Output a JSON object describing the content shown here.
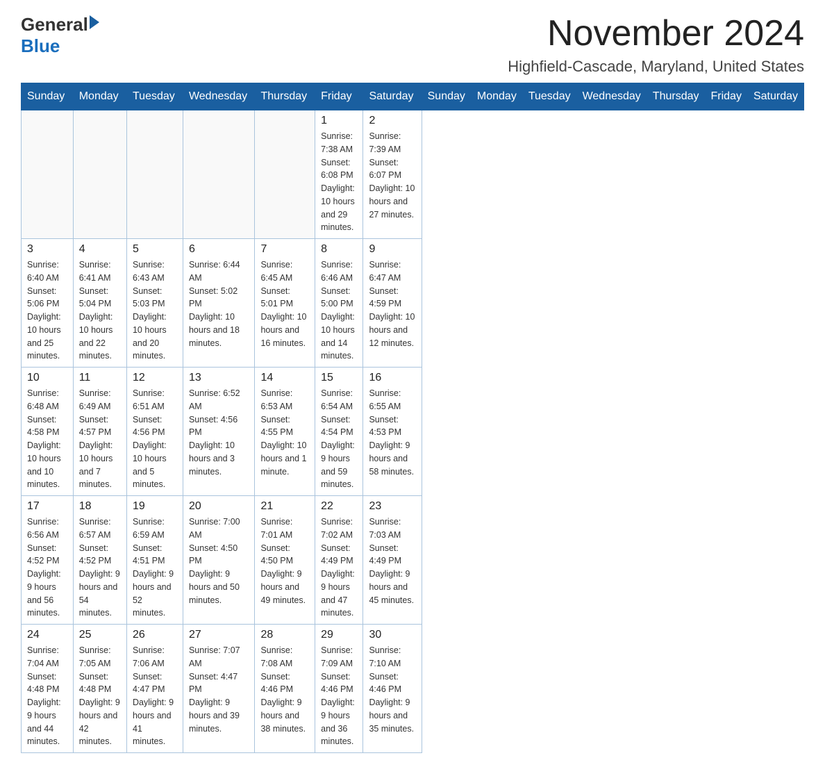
{
  "header": {
    "logo_general": "General",
    "logo_blue": "Blue",
    "month_title": "November 2024",
    "location": "Highfield-Cascade, Maryland, United States"
  },
  "days_of_week": [
    "Sunday",
    "Monday",
    "Tuesday",
    "Wednesday",
    "Thursday",
    "Friday",
    "Saturday"
  ],
  "weeks": [
    [
      {
        "day": "",
        "info": ""
      },
      {
        "day": "",
        "info": ""
      },
      {
        "day": "",
        "info": ""
      },
      {
        "day": "",
        "info": ""
      },
      {
        "day": "",
        "info": ""
      },
      {
        "day": "1",
        "info": "Sunrise: 7:38 AM\nSunset: 6:08 PM\nDaylight: 10 hours and 29 minutes."
      },
      {
        "day": "2",
        "info": "Sunrise: 7:39 AM\nSunset: 6:07 PM\nDaylight: 10 hours and 27 minutes."
      }
    ],
    [
      {
        "day": "3",
        "info": "Sunrise: 6:40 AM\nSunset: 5:06 PM\nDaylight: 10 hours and 25 minutes."
      },
      {
        "day": "4",
        "info": "Sunrise: 6:41 AM\nSunset: 5:04 PM\nDaylight: 10 hours and 22 minutes."
      },
      {
        "day": "5",
        "info": "Sunrise: 6:43 AM\nSunset: 5:03 PM\nDaylight: 10 hours and 20 minutes."
      },
      {
        "day": "6",
        "info": "Sunrise: 6:44 AM\nSunset: 5:02 PM\nDaylight: 10 hours and 18 minutes."
      },
      {
        "day": "7",
        "info": "Sunrise: 6:45 AM\nSunset: 5:01 PM\nDaylight: 10 hours and 16 minutes."
      },
      {
        "day": "8",
        "info": "Sunrise: 6:46 AM\nSunset: 5:00 PM\nDaylight: 10 hours and 14 minutes."
      },
      {
        "day": "9",
        "info": "Sunrise: 6:47 AM\nSunset: 4:59 PM\nDaylight: 10 hours and 12 minutes."
      }
    ],
    [
      {
        "day": "10",
        "info": "Sunrise: 6:48 AM\nSunset: 4:58 PM\nDaylight: 10 hours and 10 minutes."
      },
      {
        "day": "11",
        "info": "Sunrise: 6:49 AM\nSunset: 4:57 PM\nDaylight: 10 hours and 7 minutes."
      },
      {
        "day": "12",
        "info": "Sunrise: 6:51 AM\nSunset: 4:56 PM\nDaylight: 10 hours and 5 minutes."
      },
      {
        "day": "13",
        "info": "Sunrise: 6:52 AM\nSunset: 4:56 PM\nDaylight: 10 hours and 3 minutes."
      },
      {
        "day": "14",
        "info": "Sunrise: 6:53 AM\nSunset: 4:55 PM\nDaylight: 10 hours and 1 minute."
      },
      {
        "day": "15",
        "info": "Sunrise: 6:54 AM\nSunset: 4:54 PM\nDaylight: 9 hours and 59 minutes."
      },
      {
        "day": "16",
        "info": "Sunrise: 6:55 AM\nSunset: 4:53 PM\nDaylight: 9 hours and 58 minutes."
      }
    ],
    [
      {
        "day": "17",
        "info": "Sunrise: 6:56 AM\nSunset: 4:52 PM\nDaylight: 9 hours and 56 minutes."
      },
      {
        "day": "18",
        "info": "Sunrise: 6:57 AM\nSunset: 4:52 PM\nDaylight: 9 hours and 54 minutes."
      },
      {
        "day": "19",
        "info": "Sunrise: 6:59 AM\nSunset: 4:51 PM\nDaylight: 9 hours and 52 minutes."
      },
      {
        "day": "20",
        "info": "Sunrise: 7:00 AM\nSunset: 4:50 PM\nDaylight: 9 hours and 50 minutes."
      },
      {
        "day": "21",
        "info": "Sunrise: 7:01 AM\nSunset: 4:50 PM\nDaylight: 9 hours and 49 minutes."
      },
      {
        "day": "22",
        "info": "Sunrise: 7:02 AM\nSunset: 4:49 PM\nDaylight: 9 hours and 47 minutes."
      },
      {
        "day": "23",
        "info": "Sunrise: 7:03 AM\nSunset: 4:49 PM\nDaylight: 9 hours and 45 minutes."
      }
    ],
    [
      {
        "day": "24",
        "info": "Sunrise: 7:04 AM\nSunset: 4:48 PM\nDaylight: 9 hours and 44 minutes."
      },
      {
        "day": "25",
        "info": "Sunrise: 7:05 AM\nSunset: 4:48 PM\nDaylight: 9 hours and 42 minutes."
      },
      {
        "day": "26",
        "info": "Sunrise: 7:06 AM\nSunset: 4:47 PM\nDaylight: 9 hours and 41 minutes."
      },
      {
        "day": "27",
        "info": "Sunrise: 7:07 AM\nSunset: 4:47 PM\nDaylight: 9 hours and 39 minutes."
      },
      {
        "day": "28",
        "info": "Sunrise: 7:08 AM\nSunset: 4:46 PM\nDaylight: 9 hours and 38 minutes."
      },
      {
        "day": "29",
        "info": "Sunrise: 7:09 AM\nSunset: 4:46 PM\nDaylight: 9 hours and 36 minutes."
      },
      {
        "day": "30",
        "info": "Sunrise: 7:10 AM\nSunset: 4:46 PM\nDaylight: 9 hours and 35 minutes."
      }
    ]
  ]
}
